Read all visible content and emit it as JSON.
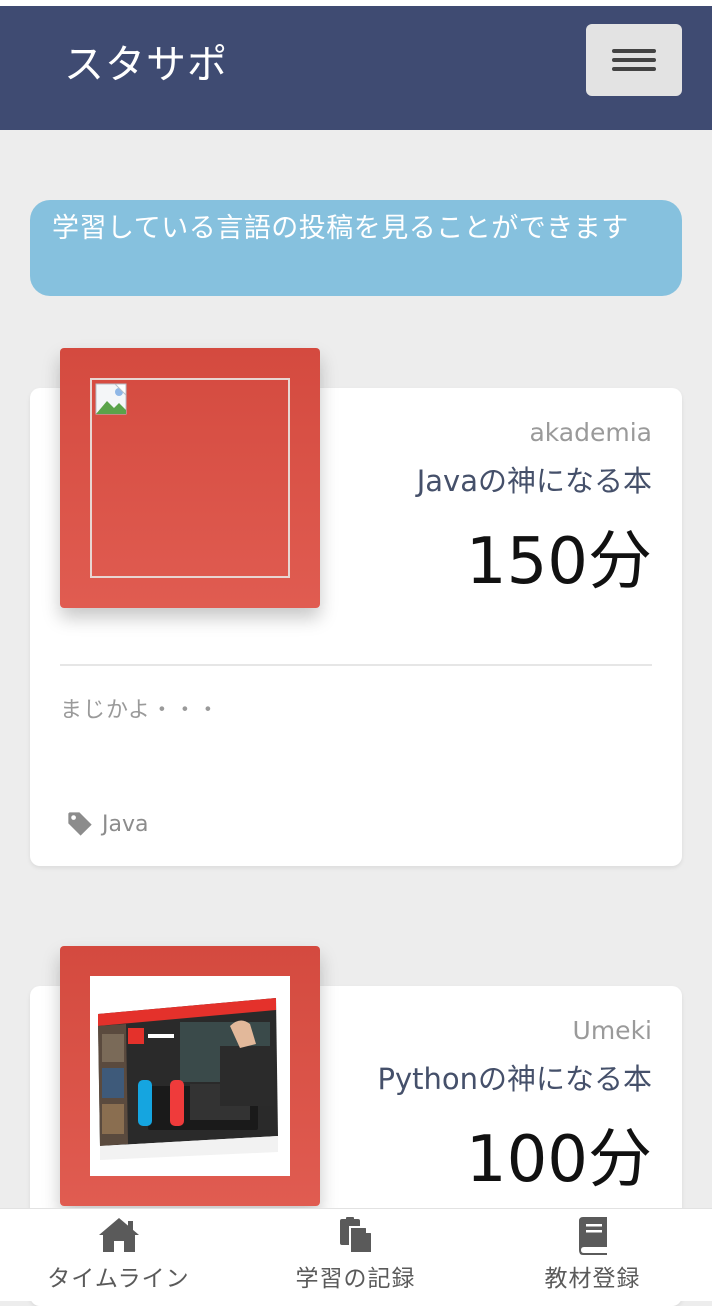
{
  "header": {
    "brand": "スタサポ",
    "menu_icon": "hamburger-icon"
  },
  "notice": {
    "text": "学習している言語の投稿を見ることができます"
  },
  "posts": [
    {
      "author": "akademia",
      "book": "Javaの神になる本",
      "minutes": "150分",
      "comment": "まじかよ・・・",
      "tag": "Java",
      "image": "broken-image-icon"
    },
    {
      "author": "Umeki",
      "book": "Pythonの神になる本",
      "minutes": "100分",
      "image": "nintendo-switch-box-photo"
    }
  ],
  "bottom_nav": [
    {
      "label": "タイムライン",
      "icon": "home-icon"
    },
    {
      "label": "学習の記録",
      "icon": "clipboard-icon"
    },
    {
      "label": "教材登録",
      "icon": "book-icon"
    }
  ],
  "colors": {
    "navbar": "#3f4b72",
    "notice": "#86c1de",
    "thumb": "#d44a3f",
    "background": "#ededed"
  }
}
